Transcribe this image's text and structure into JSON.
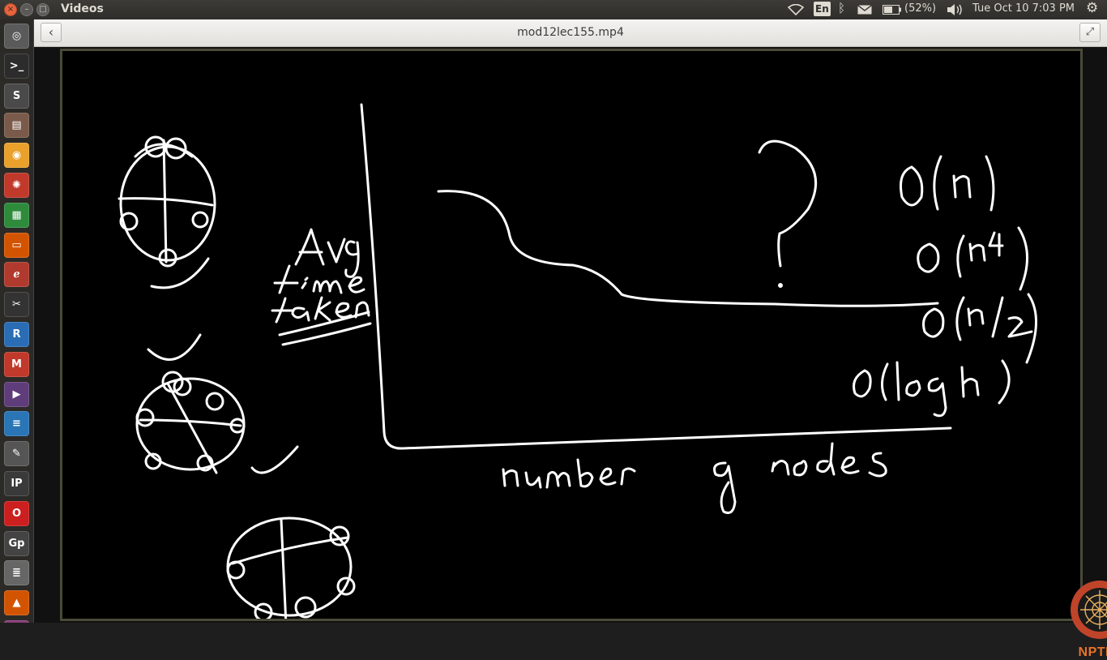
{
  "window": {
    "app_title": "Videos",
    "file_title": "mod12lec155.mp4"
  },
  "panel": {
    "keyboard": "En",
    "battery": "(52%)",
    "datetime": "Tue Oct 10  7:03 PM"
  },
  "launcher_items": [
    "dash",
    "terminal",
    "sublime-text",
    "files",
    "chrome",
    "settings",
    "spreadsheet",
    "presentation",
    "pdf-reader",
    "video-editor",
    "r",
    "gmail",
    "media",
    "document",
    "text-editor",
    "ipython",
    "opera",
    "gp",
    "stacks",
    "install",
    "more"
  ],
  "video": {
    "logo_text": "NPTEL",
    "board_text": [
      "Avg",
      "time",
      "taken",
      "?",
      "O(n)",
      "O(n^",
      "O(n/2",
      "O(log n)",
      "number of nodes"
    ]
  }
}
